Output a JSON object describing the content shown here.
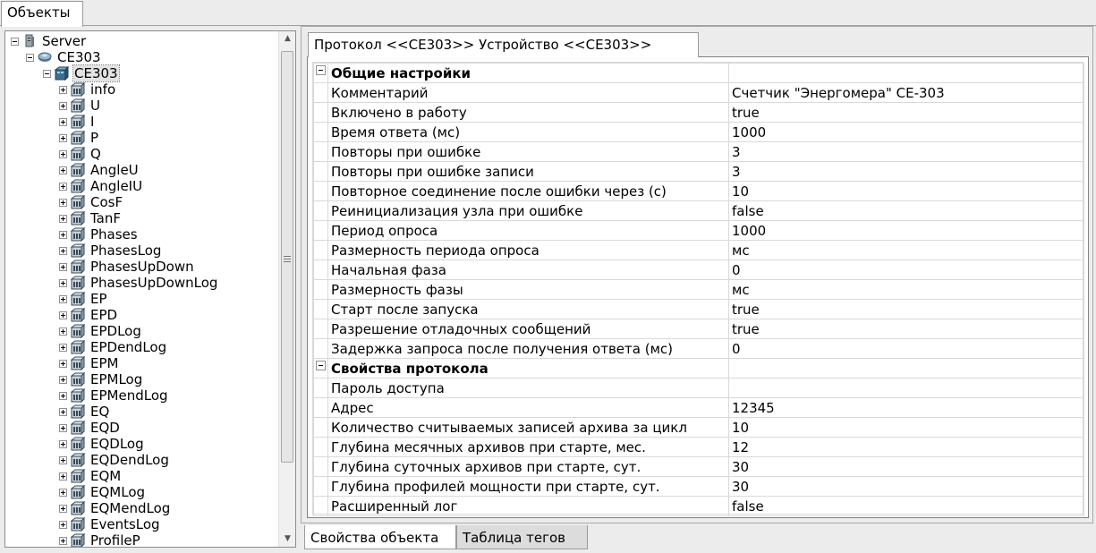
{
  "top_tab": {
    "label": "Объекты"
  },
  "tree": {
    "items": [
      {
        "label": "Server",
        "level": 0,
        "expander": "minus",
        "icon": "server-icon"
      },
      {
        "label": "CE303",
        "level": 1,
        "expander": "minus",
        "icon": "channel-icon"
      },
      {
        "label": "CE303",
        "level": 2,
        "expander": "minus",
        "icon": "device-icon",
        "selected": true
      },
      {
        "label": "info",
        "level": 3,
        "expander": "plus",
        "icon": "tag-group-icon"
      },
      {
        "label": "U",
        "level": 3,
        "expander": "plus",
        "icon": "tag-group-icon"
      },
      {
        "label": "I",
        "level": 3,
        "expander": "plus",
        "icon": "tag-group-icon"
      },
      {
        "label": "P",
        "level": 3,
        "expander": "plus",
        "icon": "tag-group-icon"
      },
      {
        "label": "Q",
        "level": 3,
        "expander": "plus",
        "icon": "tag-group-icon"
      },
      {
        "label": "AngleU",
        "level": 3,
        "expander": "plus",
        "icon": "tag-group-icon"
      },
      {
        "label": "AngleIU",
        "level": 3,
        "expander": "plus",
        "icon": "tag-group-icon"
      },
      {
        "label": "CosF",
        "level": 3,
        "expander": "plus",
        "icon": "tag-group-icon"
      },
      {
        "label": "TanF",
        "level": 3,
        "expander": "plus",
        "icon": "tag-group-icon"
      },
      {
        "label": "Phases",
        "level": 3,
        "expander": "plus",
        "icon": "tag-group-icon"
      },
      {
        "label": "PhasesLog",
        "level": 3,
        "expander": "plus",
        "icon": "tag-group-icon"
      },
      {
        "label": "PhasesUpDown",
        "level": 3,
        "expander": "plus",
        "icon": "tag-group-icon"
      },
      {
        "label": "PhasesUpDownLog",
        "level": 3,
        "expander": "plus",
        "icon": "tag-group-icon"
      },
      {
        "label": "EP",
        "level": 3,
        "expander": "plus",
        "icon": "tag-group-icon"
      },
      {
        "label": "EPD",
        "level": 3,
        "expander": "plus",
        "icon": "tag-group-icon"
      },
      {
        "label": "EPDLog",
        "level": 3,
        "expander": "plus",
        "icon": "tag-group-icon"
      },
      {
        "label": "EPDendLog",
        "level": 3,
        "expander": "plus",
        "icon": "tag-group-icon"
      },
      {
        "label": "EPM",
        "level": 3,
        "expander": "plus",
        "icon": "tag-group-icon"
      },
      {
        "label": "EPMLog",
        "level": 3,
        "expander": "plus",
        "icon": "tag-group-icon"
      },
      {
        "label": "EPMendLog",
        "level": 3,
        "expander": "plus",
        "icon": "tag-group-icon"
      },
      {
        "label": "EQ",
        "level": 3,
        "expander": "plus",
        "icon": "tag-group-icon"
      },
      {
        "label": "EQD",
        "level": 3,
        "expander": "plus",
        "icon": "tag-group-icon"
      },
      {
        "label": "EQDLog",
        "level": 3,
        "expander": "plus",
        "icon": "tag-group-icon"
      },
      {
        "label": "EQDendLog",
        "level": 3,
        "expander": "plus",
        "icon": "tag-group-icon"
      },
      {
        "label": "EQM",
        "level": 3,
        "expander": "plus",
        "icon": "tag-group-icon"
      },
      {
        "label": "EQMLog",
        "level": 3,
        "expander": "plus",
        "icon": "tag-group-icon"
      },
      {
        "label": "EQMendLog",
        "level": 3,
        "expander": "plus",
        "icon": "tag-group-icon"
      },
      {
        "label": "EventsLog",
        "level": 3,
        "expander": "plus",
        "icon": "tag-group-icon"
      },
      {
        "label": "ProfileP",
        "level": 3,
        "expander": "plus",
        "icon": "tag-group-icon"
      }
    ]
  },
  "doc_tab": {
    "label": "Протокол <<CE303>> Устройство <<CE303>>"
  },
  "properties": {
    "categories": [
      {
        "title": "Общие настройки",
        "rows": [
          {
            "name": "Комментарий",
            "value": "Счетчик \"Энергомера\" CE-303"
          },
          {
            "name": "Включено в работу",
            "value": "true"
          },
          {
            "name": "Время ответа (мс)",
            "value": "1000"
          },
          {
            "name": "Повторы при ошибке",
            "value": "3"
          },
          {
            "name": "Повторы при ошибке записи",
            "value": "3"
          },
          {
            "name": "Повторное соединение после ошибки через (с)",
            "value": "10"
          },
          {
            "name": "Реинициализация узла при ошибке",
            "value": "false"
          },
          {
            "name": "Период опроса",
            "value": "1000"
          },
          {
            "name": "Размерность периода опроса",
            "value": "мс"
          },
          {
            "name": "Начальная фаза",
            "value": "0"
          },
          {
            "name": "Размерность фазы",
            "value": "мс"
          },
          {
            "name": "Старт после запуска",
            "value": "true"
          },
          {
            "name": "Разрешение отладочных сообщений",
            "value": "true"
          },
          {
            "name": "Задержка запроса после получения ответа (мс)",
            "value": "0"
          }
        ]
      },
      {
        "title": "Свойства протокола",
        "rows": [
          {
            "name": "Пароль доступа",
            "value": ""
          },
          {
            "name": "Адрес",
            "value": "12345"
          },
          {
            "name": "Количество считываемых записей архива за цикл",
            "value": "10"
          },
          {
            "name": "Глубина месячных архивов при старте, мес.",
            "value": "12"
          },
          {
            "name": "Глубина суточных архивов при старте, сут.",
            "value": "30"
          },
          {
            "name": "Глубина профилей мощности при старте, сут.",
            "value": "30"
          },
          {
            "name": "Расширенный лог",
            "value": "false"
          }
        ]
      }
    ]
  },
  "bottom_tabs": [
    {
      "label": "Свойства объекта",
      "active": true
    },
    {
      "label": "Таблица тегов",
      "active": false
    }
  ],
  "colors": {
    "selection": "#e3e3e3",
    "grid_line": "#d9d9d9",
    "panel_bg": "#ececec"
  }
}
